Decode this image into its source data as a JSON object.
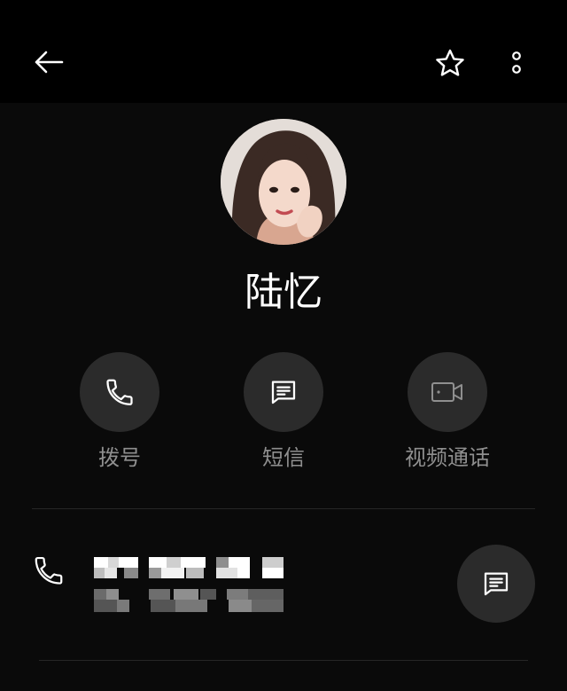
{
  "header": {
    "back_icon": "arrow-left-icon",
    "favorite_icon": "star-outline-icon",
    "more_icon": "more-vertical-icon"
  },
  "contact": {
    "name": "陆忆",
    "avatar": "portrait-photo"
  },
  "actions": [
    {
      "label": "拨号",
      "icon": "phone-icon"
    },
    {
      "label": "短信",
      "icon": "message-icon"
    },
    {
      "label": "视频通话",
      "icon": "video-call-icon"
    }
  ],
  "phone_entry": {
    "number": "",
    "type": "",
    "icon": "phone-icon",
    "message_icon": "message-icon"
  },
  "colors": {
    "background": "#0a0a0a",
    "topbar": "#000000",
    "action_circle": "#2b2b2b",
    "label": "#8f8f8f",
    "divider": "#262626"
  }
}
